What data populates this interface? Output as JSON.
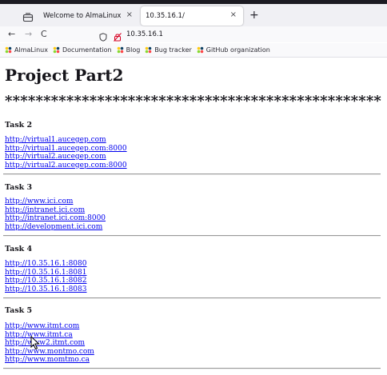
{
  "browser": {
    "tabs": [
      {
        "title": "Welcome to AlmaLinux",
        "close": "×"
      },
      {
        "title": "10.35.16.1/",
        "close": "×"
      }
    ],
    "new_tab": "+",
    "nav": {
      "back": "←",
      "forward": "→",
      "reload": "C"
    },
    "url": "10.35.16.1",
    "bookmarks": [
      {
        "label": "AlmaLinux"
      },
      {
        "label": "Documentation"
      },
      {
        "label": "Blog"
      },
      {
        "label": "Bug tracker"
      },
      {
        "label": "GitHub organization"
      }
    ]
  },
  "page": {
    "title": "Project Part2",
    "stars": "*************************************************",
    "tasks": [
      {
        "heading": "Task 2",
        "links": [
          "http://virtual1.aucegep.com",
          "http://virtual1.aucegep.com:8000",
          "http://virtual2.aucegep.com",
          "http://virtual2.aucegep.com:8000"
        ]
      },
      {
        "heading": "Task 3",
        "links": [
          "http://www.ici.com",
          "http://intranet.ici.com",
          "http://intranet.ici.com:8000",
          "http://development.ici.com"
        ]
      },
      {
        "heading": "Task 4",
        "links": [
          "http://10.35.16.1:8080",
          "http://10.35.16.1:8081",
          "http://10.35.16.1:8082",
          "http://10.35.16.1:8083"
        ]
      },
      {
        "heading": "Task 5",
        "links": [
          "http://www.itmt.com",
          "http://www.itmt.ca",
          "http://www2.itmt.com",
          "http://www.montmo.com",
          "http://www.momtmo.ca"
        ]
      }
    ]
  },
  "colors": {
    "link": "#0000ee",
    "tabstrip": "#f0f0f4",
    "toolbar": "#f9f9fb"
  }
}
